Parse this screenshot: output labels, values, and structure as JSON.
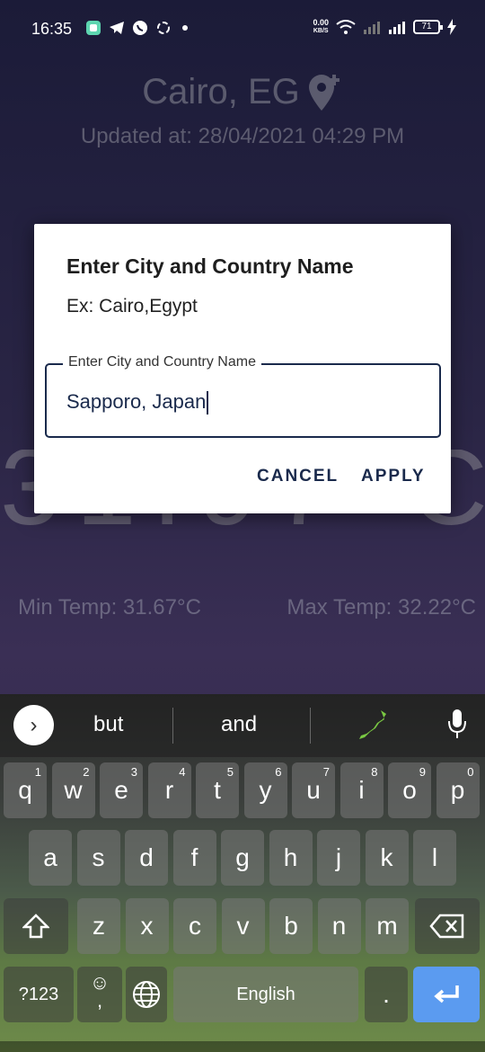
{
  "status_bar": {
    "time": "16:35",
    "speed_value": "0.00",
    "speed_unit": "KB/S",
    "battery": "71"
  },
  "weather": {
    "city": "Cairo, EG",
    "updated": "Updated at: 28/04/2021 04:29 PM",
    "temperature": "31.97°C",
    "min_temp": "Min Temp: 31.67°C",
    "max_temp": "Max Temp: 32.22°C"
  },
  "dialog": {
    "title": "Enter City and Country Name",
    "hint": "Ex: Cairo,Egypt",
    "field_label": "Enter City and Country Name",
    "field_value": "Sapporo, Japan",
    "cancel_label": "CANCEL",
    "apply_label": "APPLY"
  },
  "keyboard": {
    "suggestions": [
      "but",
      "and"
    ],
    "row1": [
      "q",
      "w",
      "e",
      "r",
      "t",
      "y",
      "u",
      "i",
      "o",
      "p"
    ],
    "row1_nums": [
      "1",
      "2",
      "3",
      "4",
      "5",
      "6",
      "7",
      "8",
      "9",
      "0"
    ],
    "row2": [
      "a",
      "s",
      "d",
      "f",
      "g",
      "h",
      "j",
      "k",
      "l"
    ],
    "row3": [
      "z",
      "x",
      "c",
      "v",
      "b",
      "n",
      "m"
    ],
    "symbols_label": "?123",
    "comma": ",",
    "space_label": "English",
    "period": "."
  },
  "colors": {
    "accent": "#1a2a4c",
    "enter_key": "#5b9bf0"
  }
}
